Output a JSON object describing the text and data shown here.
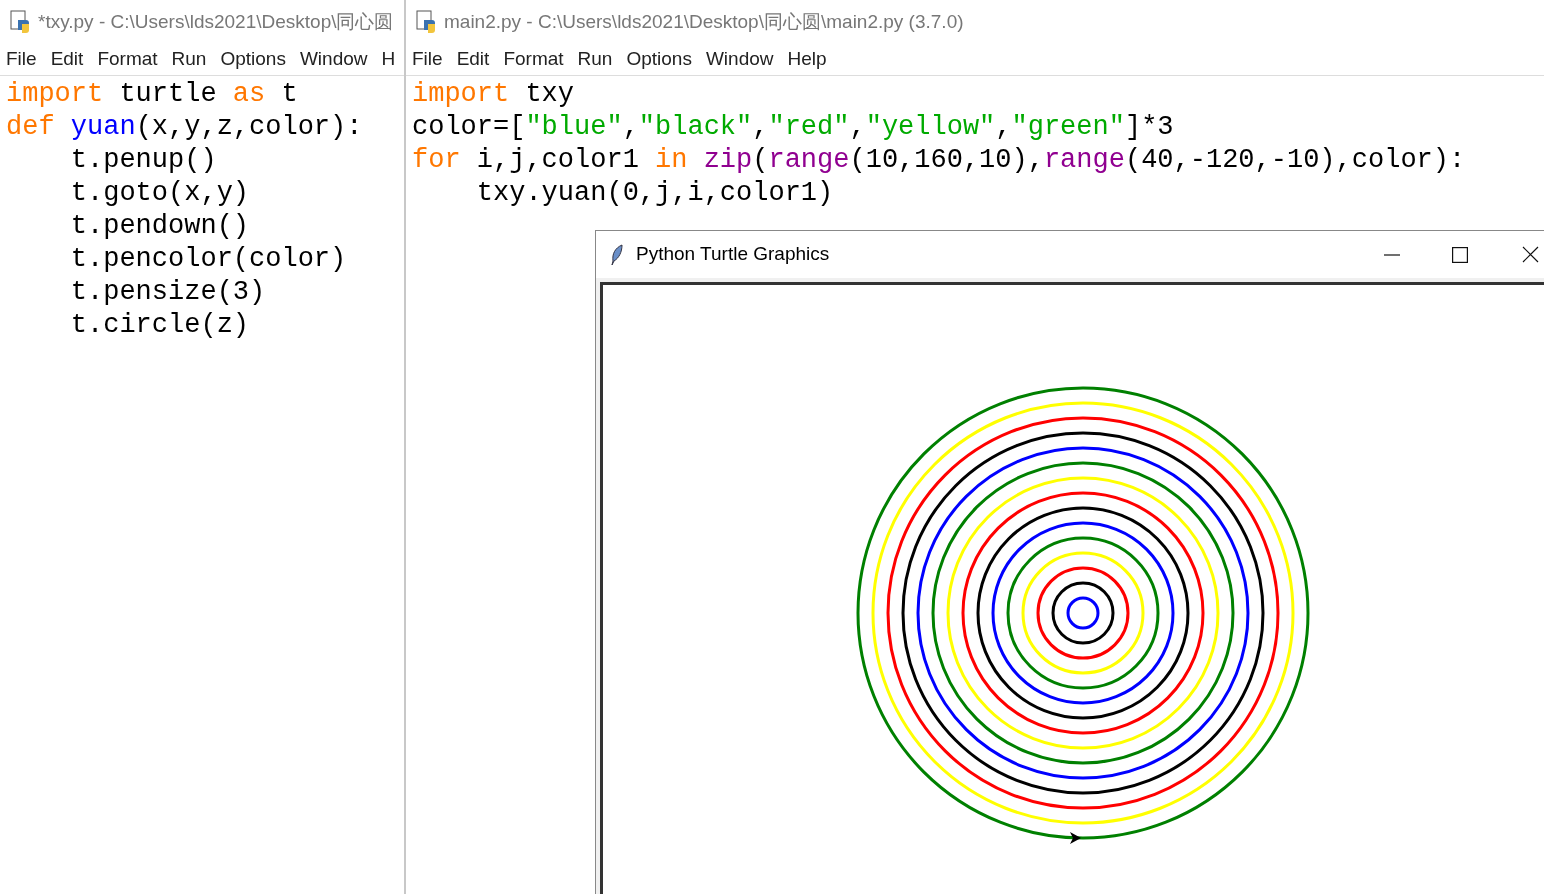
{
  "editors": [
    {
      "title": "*txy.py - C:\\Users\\lds2021\\Desktop\\同心圆",
      "menu": [
        "File",
        "Edit",
        "Format",
        "Run",
        "Options",
        "Window",
        "H"
      ],
      "code": [
        [
          {
            "kind": "keyword",
            "text": "import"
          },
          {
            "kind": "plain",
            "text": " turtle "
          },
          {
            "kind": "keyword",
            "text": "as"
          },
          {
            "kind": "plain",
            "text": " t"
          }
        ],
        [
          {
            "kind": "keyword",
            "text": "def "
          },
          {
            "kind": "definition",
            "text": "yuan"
          },
          {
            "kind": "plain",
            "text": "(x,y,z,color):"
          }
        ],
        [
          {
            "kind": "plain",
            "text": "    t.penup()"
          }
        ],
        [
          {
            "kind": "plain",
            "text": "    t.goto(x,y)"
          }
        ],
        [
          {
            "kind": "plain",
            "text": "    t.pendown()"
          }
        ],
        [
          {
            "kind": "plain",
            "text": "    t.pencolor(color)"
          }
        ],
        [
          {
            "kind": "plain",
            "text": "    t.pensize(3)"
          }
        ],
        [
          {
            "kind": "plain",
            "text": "    t.circle(z)"
          }
        ]
      ]
    },
    {
      "title": "main2.py - C:\\Users\\lds2021\\Desktop\\同心圆\\main2.py (3.7.0)",
      "menu": [
        "File",
        "Edit",
        "Format",
        "Run",
        "Options",
        "Window",
        "Help"
      ],
      "code": [
        [
          {
            "kind": "keyword",
            "text": "import"
          },
          {
            "kind": "plain",
            "text": " txy"
          }
        ],
        [
          {
            "kind": "plain",
            "text": "color=["
          },
          {
            "kind": "string",
            "text": "\"blue\""
          },
          {
            "kind": "plain",
            "text": ","
          },
          {
            "kind": "string",
            "text": "\"black\""
          },
          {
            "kind": "plain",
            "text": ","
          },
          {
            "kind": "string",
            "text": "\"red\""
          },
          {
            "kind": "plain",
            "text": ","
          },
          {
            "kind": "string",
            "text": "\"yellow\""
          },
          {
            "kind": "plain",
            "text": ","
          },
          {
            "kind": "string",
            "text": "\"green\""
          },
          {
            "kind": "plain",
            "text": "]*3"
          }
        ],
        [
          {
            "kind": "keyword",
            "text": "for"
          },
          {
            "kind": "plain",
            "text": " i,j,color1 "
          },
          {
            "kind": "keyword",
            "text": "in "
          },
          {
            "kind": "builtin",
            "text": "zip"
          },
          {
            "kind": "plain",
            "text": "("
          },
          {
            "kind": "builtin",
            "text": "range"
          },
          {
            "kind": "plain",
            "text": "(10,160,10),"
          },
          {
            "kind": "builtin",
            "text": "range"
          },
          {
            "kind": "plain",
            "text": "(40,-120,-10),color):"
          }
        ],
        [
          {
            "kind": "plain",
            "text": "    txy.yuan(0,j,i,color1)"
          }
        ]
      ]
    }
  ],
  "turtle_window": {
    "title": "Python Turtle Graphics"
  }
}
